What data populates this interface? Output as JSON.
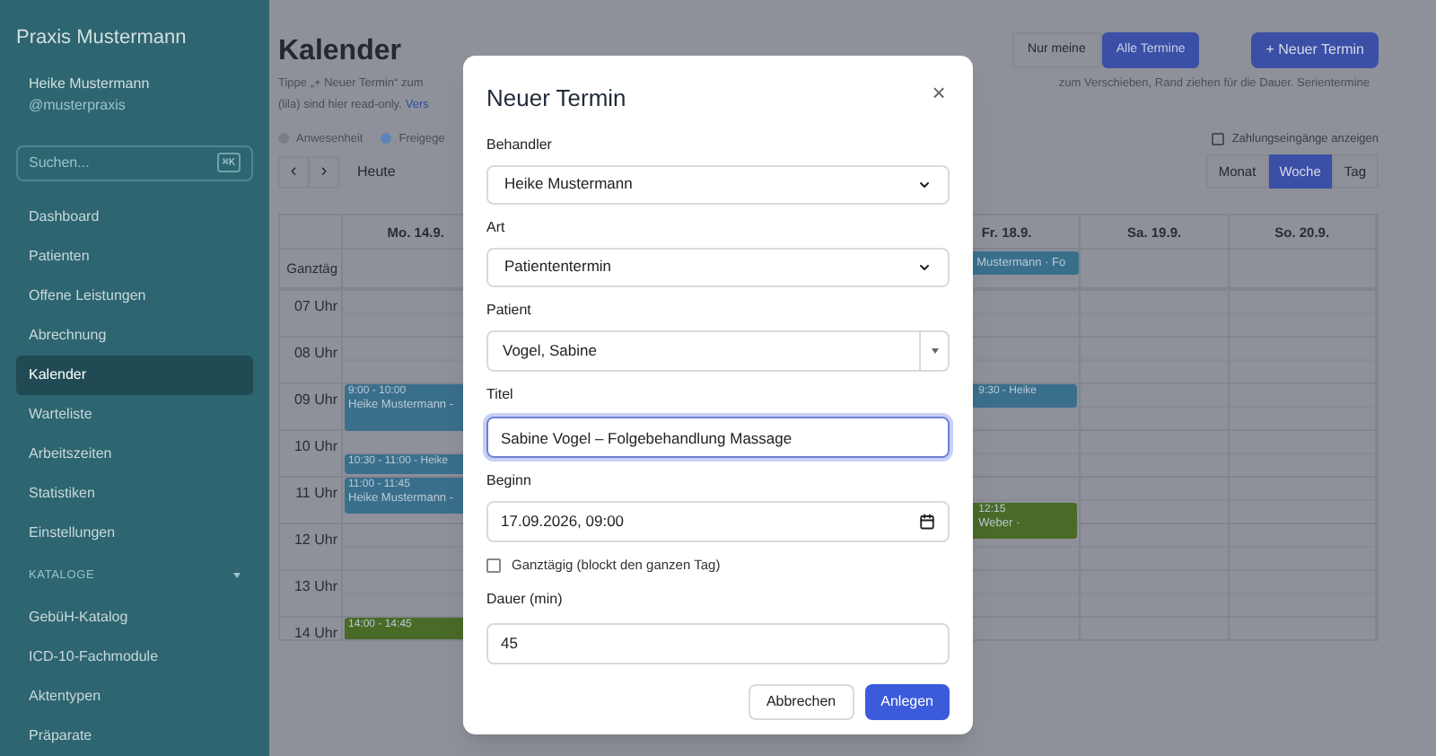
{
  "sidebar": {
    "brand": "Praxis Mustermann",
    "user": "Heike Mustermann",
    "handle": "@musterpraxis",
    "search": {
      "placeholder": "Suchen...",
      "shortcut": "⌘K"
    },
    "items": [
      {
        "label": "Dashboard",
        "selected": false
      },
      {
        "label": "Patienten",
        "selected": false
      },
      {
        "label": "Offene Leistungen",
        "selected": false
      },
      {
        "label": "Abrechnung",
        "selected": false
      },
      {
        "label": "Kalender",
        "selected": true
      },
      {
        "label": "Warteliste",
        "selected": false
      },
      {
        "label": "Arbeitszeiten",
        "selected": false
      },
      {
        "label": "Statistiken",
        "selected": false
      },
      {
        "label": "Einstellungen",
        "selected": false
      }
    ],
    "section": {
      "label": "KATALOGE",
      "expanded": true,
      "items": [
        {
          "label": "GebüH-Katalog"
        },
        {
          "label": "ICD-10-Fachmodule"
        },
        {
          "label": "Aktentypen"
        },
        {
          "label": "Präparate"
        }
      ]
    }
  },
  "page": {
    "title": "Kalender",
    "filter": [
      {
        "label": "Nur meine",
        "selected": false
      },
      {
        "label": "Alle Termine",
        "selected": true
      }
    ],
    "new_button": "+ Neuer Termin",
    "hint_left": "Tippe „+ Neuer Termin“ zum",
    "hint_right": "zum Verschieben, Rand ziehen für die Dauer. Serientermine",
    "hint_line2": "(lila) sind hier read-only.",
    "hint_link": "Vers",
    "legend": [
      {
        "label": "Anwesenheit",
        "color": "#7a7d85"
      },
      {
        "label": "Freigege",
        "color": "#5b84b8"
      }
    ],
    "payments": {
      "label": "Zahlungseingänge anzeigen",
      "checked": false
    },
    "nav": {
      "prev": "‹",
      "next": "›",
      "today": "Heute"
    },
    "views": [
      {
        "label": "Monat",
        "selected": false
      },
      {
        "label": "Woche",
        "selected": true
      },
      {
        "label": "Tag",
        "selected": false
      }
    ]
  },
  "calendar": {
    "all_day_label": "Ganztäg",
    "hours": [
      "07 Uhr",
      "08 Uhr",
      "09 Uhr",
      "10 Uhr",
      "11 Uhr",
      "12 Uhr",
      "13 Uhr",
      "14 Uhr"
    ],
    "days": [
      {
        "label": "Mo. 14.9.",
        "events": [
          {
            "time": "9:00 - 10:00",
            "title": "Heike Mustermann -",
            "color": "#3a6f8c"
          },
          {
            "time": "10:30 - 11:00 - Heike",
            "color": "#3a6f8c"
          },
          {
            "time": "11:00 - 11:45",
            "title": "Heike Mustermann -",
            "color": "#3a6f8c"
          },
          {
            "time": "14:00 - 14:45",
            "color": "#4a6a28"
          }
        ]
      },
      {
        "label": "Fr. 18.9.",
        "all_day": [
          {
            "title": "Mustermann · Fo",
            "color": "#3a6f8c"
          }
        ],
        "events": [
          {
            "time": "9:30 - Heike",
            "color": "#3a6f8c"
          },
          {
            "time": "12:15",
            "title": "Weber ·",
            "color": "#4a6a28"
          }
        ]
      },
      {
        "label": "Sa. 19.9."
      },
      {
        "label": "So. 20.9."
      }
    ]
  },
  "dialog": {
    "title": "Neuer Termin",
    "close": "×",
    "fields": [
      {
        "kind": "select",
        "label": "Behandler",
        "value": "Heike Mustermann"
      },
      {
        "kind": "select",
        "label": "Art",
        "value": "Patiententermin"
      },
      {
        "kind": "combo",
        "label": "Patient",
        "value": "Vogel, Sabine"
      },
      {
        "kind": "text",
        "label": "Titel",
        "value": "Sabine Vogel – Folgebehandlung Massage",
        "focused": true
      },
      {
        "kind": "datetime",
        "label": "Beginn",
        "value": "17.09.2026, 09:00"
      },
      {
        "kind": "checkbox",
        "label": "Ganztägig (blockt den ganzen Tag)",
        "checked": false
      },
      {
        "kind": "text",
        "label": "Dauer (min)",
        "value": "45",
        "focused": false
      }
    ],
    "buttons": [
      {
        "label": "Abbrechen",
        "kind": "secondary"
      },
      {
        "label": "Anlegen",
        "kind": "primary"
      }
    ]
  }
}
